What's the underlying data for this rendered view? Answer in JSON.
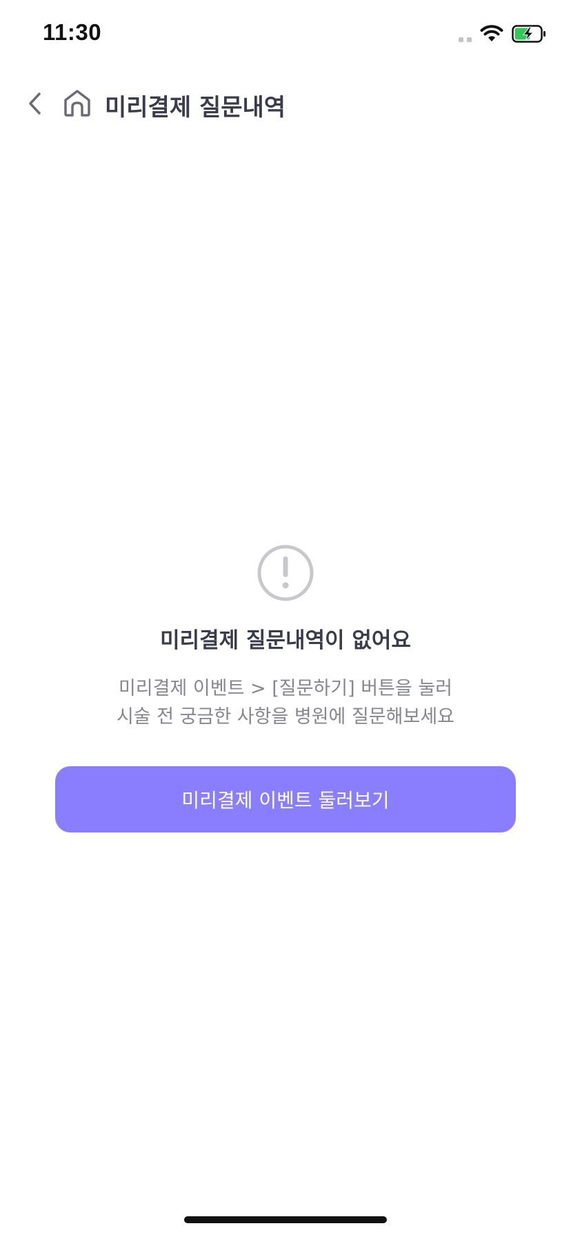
{
  "status_bar": {
    "time": "11:30",
    "icons": [
      "signal-icon",
      "wifi-icon",
      "battery-charging-icon"
    ],
    "battery_color": "#34c759"
  },
  "header": {
    "back_icon": "chevron-left-icon",
    "home_icon": "home-icon",
    "title": "미리결제 질문내역"
  },
  "empty_state": {
    "icon": "exclamation-circle-icon",
    "title": "미리결제 질문내역이 없어요",
    "description_line1": "미리결제 이벤트 > [질문하기] 버튼을 눌러",
    "description_line2": "시술 전 궁금한 사항을 병원에 질문해보세요"
  },
  "cta": {
    "label": "미리결제 이벤트 둘러보기",
    "color": "#8a7eff"
  }
}
